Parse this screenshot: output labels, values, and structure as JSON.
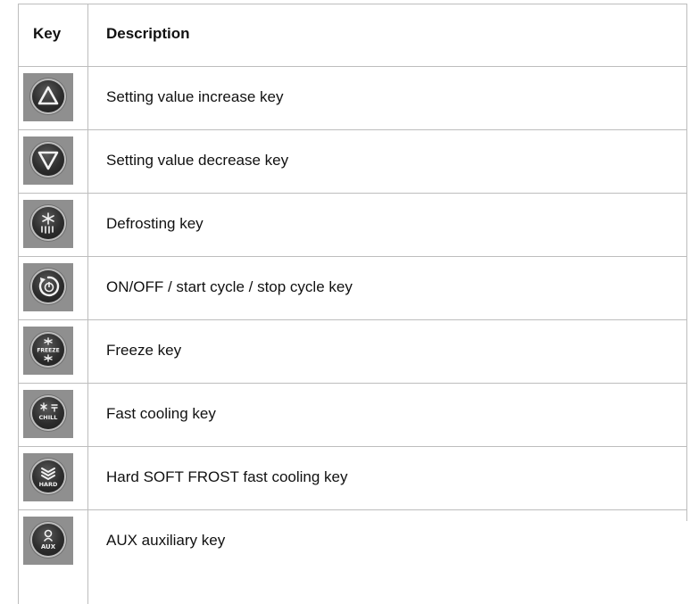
{
  "table": {
    "header": {
      "key": "Key",
      "description": "Description"
    },
    "rows": [
      {
        "icon": "triangle-up-icon",
        "description": "Setting value increase key"
      },
      {
        "icon": "triangle-down-icon",
        "description": "Setting value decrease key"
      },
      {
        "icon": "snowflake-defrost-icon",
        "description": "Defrosting key"
      },
      {
        "icon": "power-cycle-icon",
        "description": "ON/OFF / start cycle / stop cycle key"
      },
      {
        "icon": "freeze-icon",
        "icon_text": "FREEZE",
        "description": "Freeze key"
      },
      {
        "icon": "chill-icon",
        "icon_text": "CHILL",
        "description": "Fast cooling key"
      },
      {
        "icon": "hard-icon",
        "icon_text": "HARD",
        "description": "Hard SOFT FROST fast cooling key"
      },
      {
        "icon": "aux-icon",
        "icon_text": "AUX",
        "description": "AUX auxiliary key"
      }
    ]
  }
}
